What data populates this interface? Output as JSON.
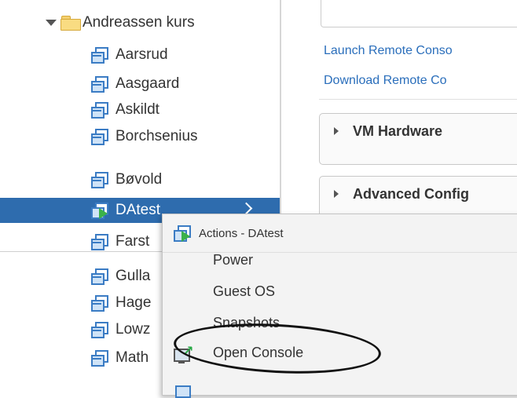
{
  "tree": {
    "folder": {
      "label": "Andreassen kurs",
      "icon": "folder-icon",
      "expanded": true
    },
    "items": [
      {
        "label": "Aarsrud",
        "icon": "vm-icon"
      },
      {
        "label": "Aasgaard",
        "icon": "vm-icon"
      },
      {
        "label": "Askildt",
        "icon": "vm-icon"
      },
      {
        "label": "Borchsenius",
        "icon": "vm-icon"
      },
      {
        "label": "Bøvold",
        "icon": "vm-icon"
      },
      {
        "label": "DAtest",
        "icon": "vm-powered-on-icon",
        "selected": true
      },
      {
        "label": "Farst",
        "icon": "vm-icon"
      },
      {
        "label": "Gulla",
        "icon": "vm-icon"
      },
      {
        "label": "Hage",
        "icon": "vm-icon"
      },
      {
        "label": "Lowz",
        "icon": "vm-icon"
      },
      {
        "label": "Math",
        "icon": "vm-icon"
      }
    ],
    "selection_color": "#2e6cae"
  },
  "details": {
    "links": {
      "launch": "Launch Remote Conso",
      "download": "Download Remote Co"
    },
    "sections": {
      "hardware": "VM Hardware",
      "advanced": "Advanced Config"
    },
    "link_color": "#2a6ebb"
  },
  "context_menu": {
    "title": "Actions - DAtest",
    "items": {
      "power": "Power",
      "guest_os": "Guest OS",
      "snapshots": "Snapshots",
      "open_console": "Open Console"
    },
    "open_console_icon": "console-icon"
  }
}
